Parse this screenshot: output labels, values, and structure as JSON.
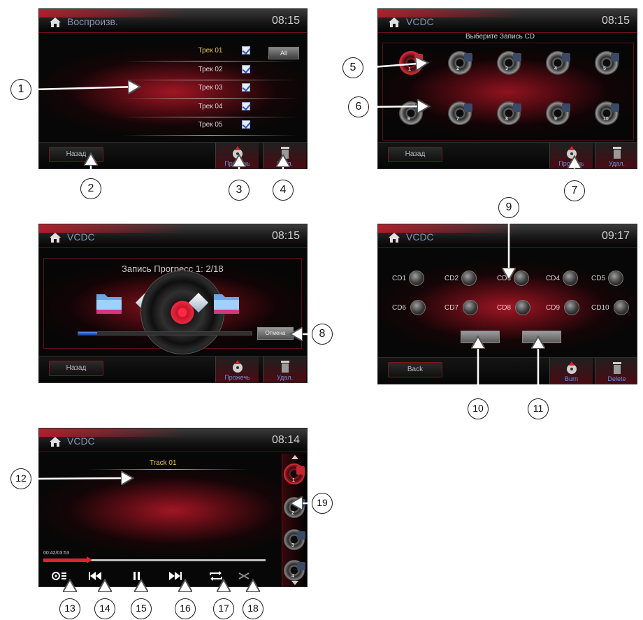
{
  "screens": {
    "playlist": {
      "title": "Воспроизв.",
      "time": "08:15",
      "tracks": [
        "Трек 01",
        "Трек 02",
        "Трек 03",
        "Трек 04",
        "Трек 05"
      ],
      "selected_track_index": 0,
      "all_label": "All",
      "back_label": "Назад",
      "burn_label": "Прожечь",
      "delete_label": "Удал."
    },
    "select_cd": {
      "title": "VCDC",
      "time": "08:15",
      "heading": "Выберите Запись CD",
      "discs": [
        "1",
        "2",
        "3",
        "4",
        "5",
        "6",
        "7",
        "8",
        "9",
        "10"
      ],
      "selected_disc_index": 0,
      "back_label": "Назад",
      "burn_label": "Прожечь",
      "delete_label": "Удал."
    },
    "progress": {
      "title": "VCDC",
      "time": "08:15",
      "status": "Запись Прогресс 1: 2/18",
      "progress_fraction": 0.11,
      "cancel_label": "Отмена",
      "back_label": "Назад",
      "burn_label": "Прожечь",
      "delete_label": "Удал."
    },
    "cd_grid": {
      "title": "VCDC",
      "time": "09:17",
      "cds": [
        "CD1",
        "CD2",
        "CD3",
        "CD4",
        "CD5",
        "CD6",
        "CD7",
        "CD8",
        "CD9",
        "CD10"
      ],
      "back_label": "Back",
      "burn_label": "Burn",
      "delete_label": "Delete"
    },
    "player": {
      "title": "VCDC",
      "time": "08:14",
      "track": "Track 01",
      "elapsed": "00:42/03:53",
      "seek_fraction": 0.2,
      "side_discs": [
        "1",
        "2",
        "3",
        "4"
      ]
    }
  },
  "callouts": [
    "1",
    "2",
    "3",
    "4",
    "5",
    "6",
    "7",
    "8",
    "9",
    "10",
    "11",
    "12",
    "13",
    "14",
    "15",
    "16",
    "17",
    "18",
    "19"
  ],
  "colors": {
    "accent_red": "#d41c2c",
    "track_selected": "#e6c84b",
    "label_blue": "#6f8fe0",
    "title_blue": "#8b95b7"
  },
  "icons": [
    "home-icon",
    "checkbox-icon",
    "burn-icon",
    "trash-icon",
    "disc-icon",
    "folder-icon",
    "cd-ball-icon",
    "eq-icon",
    "prev-icon",
    "pause-icon",
    "next-icon",
    "repeat-icon",
    "shuffle-icon",
    "scroll-up-icon",
    "scroll-down-icon"
  ]
}
